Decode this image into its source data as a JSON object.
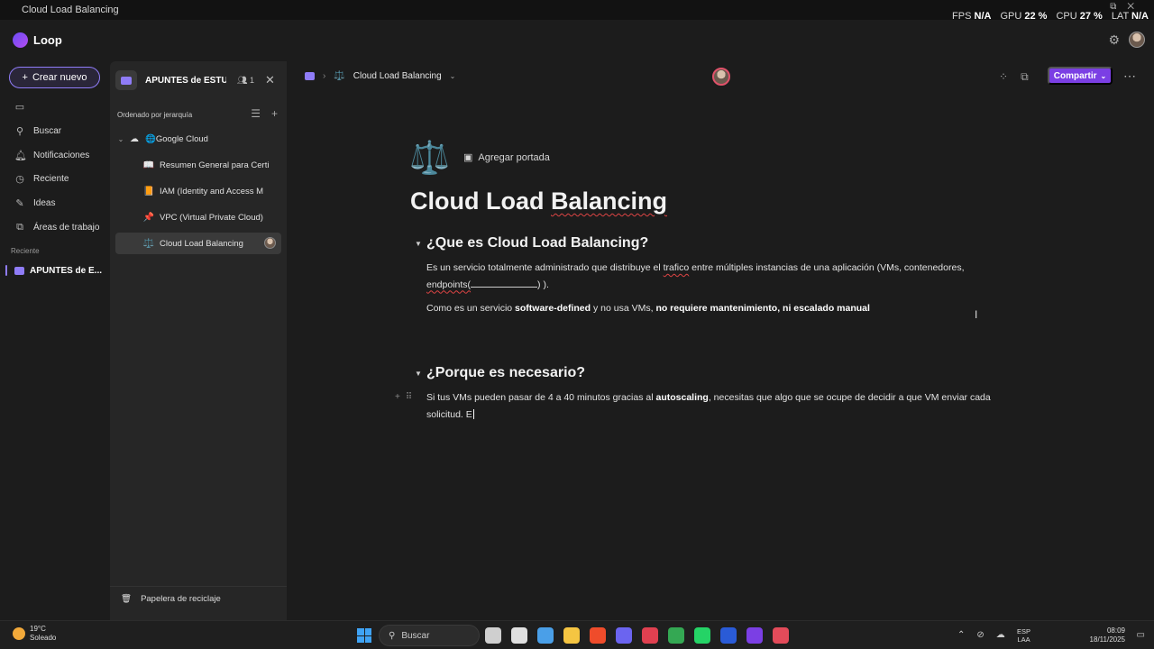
{
  "window": {
    "title": "Cloud Load Balancing"
  },
  "perf": {
    "fps_label": "FPS",
    "fps": "N/A",
    "gpu_label": "GPU",
    "gpu": "22 %",
    "cpu_label": "CPU",
    "cpu": "27 %",
    "lat_label": "LAT",
    "lat": "N/A"
  },
  "app": {
    "name": "Loop"
  },
  "leftnav": {
    "new_button": "Crear nuevo",
    "items": [
      {
        "label": "",
        "icon": "panel-toggle-icon"
      },
      {
        "label": "Buscar",
        "icon": "search-icon"
      },
      {
        "label": "Notificaciones",
        "icon": "bell-icon"
      },
      {
        "label": "Reciente",
        "icon": "clock-icon"
      },
      {
        "label": "Ideas",
        "icon": "pen-icon"
      },
      {
        "label": "Áreas de trabajo",
        "icon": "workspaces-icon"
      }
    ],
    "recent_label": "Reciente",
    "recent_item": "APUNTES de E..."
  },
  "sidepanel": {
    "workspace_title": "APUNTES de ESTU...",
    "members": "1",
    "sort_label": "Ordenado por jerarquía",
    "tree": [
      {
        "label": "Google Cloud",
        "emoji": "🌐"
      },
      {
        "label": "Resumen General para Certi",
        "emoji": "📖"
      },
      {
        "label": "IAM (Identity and Access M",
        "emoji": "📙"
      },
      {
        "label": "VPC (Virtual Private Cloud)",
        "emoji": "📌"
      },
      {
        "label": "Cloud Load Balancing",
        "emoji": "⚖️"
      }
    ],
    "recycle": "Papelera de reciclaje"
  },
  "topbar": {
    "breadcrumb": "Cloud Load Balancing",
    "share": "Compartir"
  },
  "doc": {
    "emoji": "⚖️",
    "add_cover": "Agregar portada",
    "title_a": "Cloud Load ",
    "title_b": "Balancing",
    "sections": [
      {
        "heading": "¿Que es Cloud Load Balancing?",
        "p1_a": "Es un servicio totalmente administrado que distribuye el ",
        "p1_link": "trafico",
        "p1_b": " entre múltiples instancias de una aplicación (VMs, contenedores,",
        "p1_c": "endpoints(",
        "p1_d": ") ).",
        "p2_a": "Como es un servicio ",
        "p2_b": "software-defined",
        "p2_c": " y no usa VMs, ",
        "p2_d": "no requiere mantenimiento, ni escalado manual"
      },
      {
        "heading": "¿Porque es necesario?",
        "p1_a": "Si tus VMs pueden pasar de 4 a 40 minutos gracias al ",
        "p1_b": "autoscaling",
        "p1_c": ", necesitas que algo que se ocupe de decidir a que VM enviar cada",
        "p1_d": "solicitud. E"
      }
    ]
  },
  "taskbar": {
    "temp": "19°C",
    "weather": "Soleado",
    "search": "Buscar",
    "lang1": "ESP",
    "lang2": "LAA",
    "time": "08:09",
    "date": "18/11/2025",
    "apps": [
      "#cfcfcf",
      "#e0e0e0",
      "#4a9fe8",
      "#f5c542",
      "#ef4c2b",
      "#6b64f0",
      "#e04050",
      "#34a853",
      "#25d366",
      "#2a5bd7",
      "#7b3fe4",
      "#e34b5a"
    ]
  }
}
